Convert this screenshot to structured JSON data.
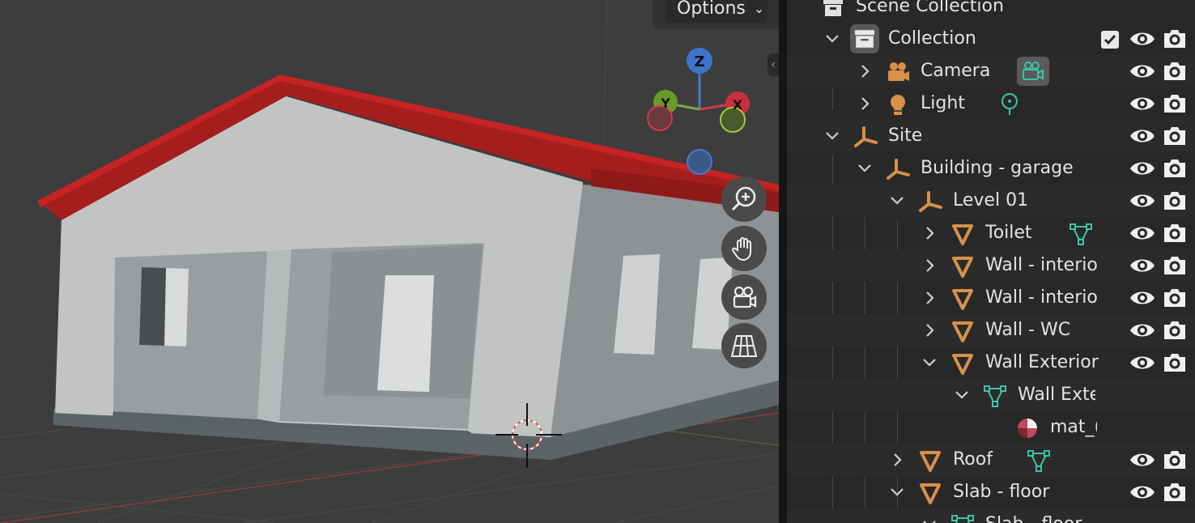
{
  "viewport": {
    "options_label": "Options",
    "gizmo": {
      "z": "Z",
      "y": "Y",
      "x": "X"
    },
    "nav_buttons": [
      "zoom-icon",
      "hand-pan-icon",
      "camera-view-icon",
      "grid-perspective-icon"
    ],
    "colors": {
      "roof": "#a51e1e",
      "wall_light": "#c2c4c4",
      "wall_shade": "#8e9294",
      "floor": "#5d6468",
      "background": "#3d3d3d"
    }
  },
  "outliner": {
    "root": {
      "label": "Scene Collection"
    },
    "rows": [
      {
        "label": "Collection",
        "icon": "collection-icon",
        "expanded": true,
        "checkbox": true
      },
      {
        "label": "Camera",
        "icon": "camera-object-icon",
        "extra": "camera-data-icon"
      },
      {
        "label": "Light",
        "icon": "light-object-icon",
        "extra": "light-data-icon"
      },
      {
        "label": "Site",
        "icon": "empty-icon",
        "expanded": true
      },
      {
        "label": "Building - garage",
        "icon": "empty-icon",
        "expanded": true
      },
      {
        "label": "Level 01",
        "icon": "empty-icon",
        "expanded": true
      },
      {
        "label": "Toilet",
        "icon": "mesh-object-icon",
        "extra": "mesh-data-icon"
      },
      {
        "label": "Wall - interio",
        "icon": "mesh-object-icon"
      },
      {
        "label": "Wall - interio",
        "icon": "mesh-object-icon"
      },
      {
        "label": "Wall - WC",
        "icon": "mesh-object-icon"
      },
      {
        "label": "Wall Exterior",
        "icon": "mesh-object-icon",
        "expanded": true
      },
      {
        "label": "Wall Exte",
        "icon": "mesh-data-icon",
        "expanded": true
      },
      {
        "label": "mat_(",
        "icon": "material-icon"
      },
      {
        "label": "Roof",
        "icon": "mesh-object-icon",
        "extra": "mesh-data-icon"
      },
      {
        "label": "Slab - floor",
        "icon": "mesh-object-icon",
        "expanded": true
      },
      {
        "label": "Slab - floor",
        "icon": "mesh-data-icon",
        "expanded": true
      }
    ]
  }
}
